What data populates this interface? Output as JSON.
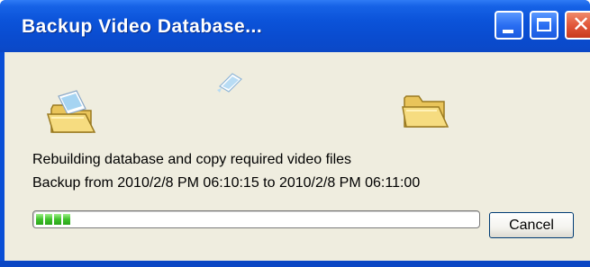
{
  "window": {
    "title": "Backup Video Database...",
    "title_color": "#ffffff",
    "titlebar_color": "#0b53d9",
    "client_color": "#efeddf"
  },
  "titlebar_buttons": {
    "minimize_icon": "minimize-icon",
    "maximize_icon": "maximize-icon",
    "close_icon": "close-icon",
    "close_glyph": "✕"
  },
  "animation": {
    "source_icon": "open-folder-icon",
    "moving_icon": "flying-document-icon",
    "destination_icon": "folder-icon"
  },
  "status": {
    "line1": "Rebuilding database and copy required video files",
    "line2": "Backup from 2010/2/8 PM 06:10:15 to 2010/2/8 PM 06:11:00"
  },
  "progress": {
    "segments_filled": 4,
    "fraction": 0.08,
    "color": "#3fc12a"
  },
  "buttons": {
    "cancel_label": "Cancel"
  }
}
